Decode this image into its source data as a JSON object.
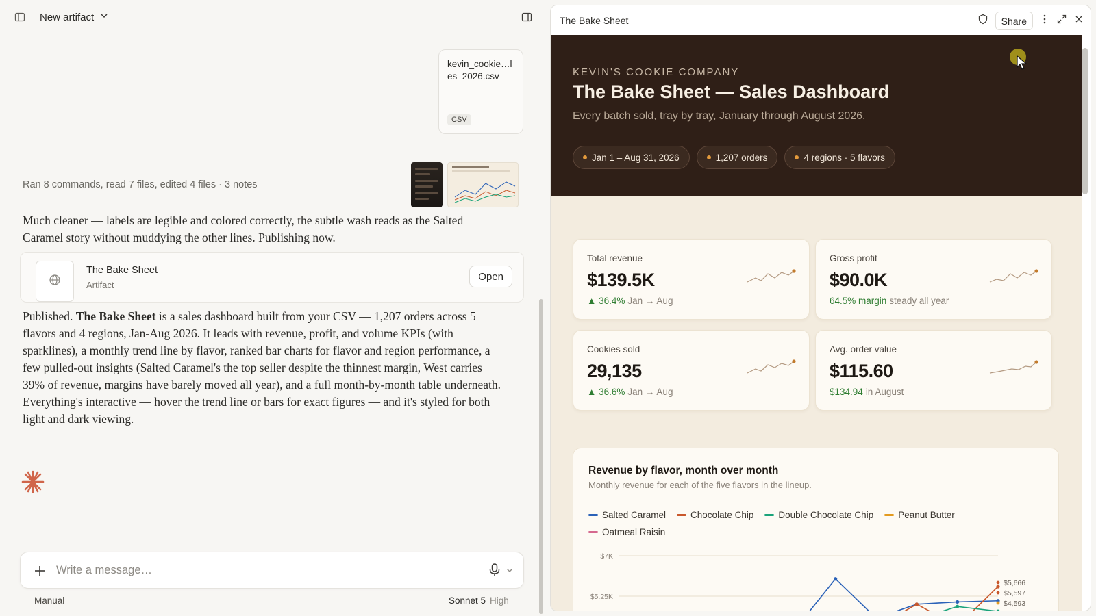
{
  "left": {
    "title": "New artifact",
    "attachment": {
      "name": "kevin_cookie_sales_2026.csv",
      "name_display": "kevin_cookie…les_2026.csv",
      "badge": "CSV"
    },
    "activity": "Ran 8 commands, read 7 files, edited 4 files · 3 notes",
    "message1": "Much cleaner — labels are legible and colored correctly, the subtle wash reads as the Salted Caramel story without muddying the other lines. Publishing now.",
    "artifact_card": {
      "title": "The Bake Sheet",
      "subtitle": "Artifact",
      "open_label": "Open"
    },
    "message2_prefix": "Published. ",
    "message2_bold": "The Bake Sheet",
    "message2_rest": " is a sales dashboard built from your CSV — 1,207 orders across 5 flavors and 4 regions, Jan-Aug 2026. It leads with revenue, profit, and volume KPIs (with sparklines), a monthly trend line by flavor, ranked bar charts for flavor and region performance, a few pulled-out insights (Salted Caramel's the top seller despite the thinnest margin, West carries 39% of revenue, margins have barely moved all year), and a full month-by-month table underneath. Everything's interactive — hover the trend line or bars for exact figures — and it's styled for both light and dark viewing.",
    "composer": {
      "placeholder": "Write a message…"
    },
    "mode": "Manual",
    "model": "Sonnet 5",
    "effort": "High"
  },
  "right": {
    "title": "The Bake Sheet",
    "share_label": "Share",
    "hero": {
      "kicker": "KEVIN'S COOKIE COMPANY",
      "title": "The Bake Sheet — Sales Dashboard",
      "subtitle": "Every batch sold, tray by tray, January through August 2026.",
      "chips": [
        "Jan 1 – Aug 31, 2026",
        "1,207 orders",
        "4 regions · 5 flavors"
      ]
    },
    "kpis": [
      {
        "label": "Total revenue",
        "value": "$139.5K",
        "delta": "▲ 36.4%",
        "note": "Jan → Aug"
      },
      {
        "label": "Gross profit",
        "value": "$90.0K",
        "delta": "64.5% margin",
        "note": "steady all year"
      },
      {
        "label": "Cookies sold",
        "value": "29,135",
        "delta": "▲ 36.6%",
        "note": "Jan → Aug"
      },
      {
        "label": "Avg. order value",
        "value": "$115.60",
        "delta": "$134.94",
        "note": "in August"
      }
    ],
    "chart": {
      "title": "Revenue by flavor, month over month",
      "subtitle": "Monthly revenue for each of the five flavors in the lineup."
    }
  },
  "colors": {
    "salted_caramel": "#2b62b8",
    "chocolate_chip": "#c9582c",
    "double_chocolate_chip": "#1aa37a",
    "peanut_butter": "#e39a1f",
    "oatmeal_raisin": "#d5688e",
    "hero_bg": "#2f1f17",
    "positive": "#2f7d32"
  },
  "chart_data": {
    "type": "line",
    "title": "Revenue by flavor, month over month",
    "y_tick_labels": [
      "$7K",
      "$5.25K"
    ],
    "end_labels": [
      "$5,666",
      "$5,597",
      "$4,593"
    ],
    "series": [
      {
        "name": "Salted Caramel",
        "color": "#2b62b8",
        "values_visible": [
          null,
          null,
          null,
          null,
          3800,
          6000,
          4300,
          4900,
          5000,
          5050
        ]
      },
      {
        "name": "Chocolate Chip",
        "color": "#c9582c",
        "values_visible": [
          null,
          null,
          null,
          null,
          null,
          4200,
          3900,
          4900,
          3950,
          5666
        ]
      },
      {
        "name": "Double Chocolate Chip",
        "color": "#1aa37a",
        "values_visible": [
          null,
          null,
          null,
          null,
          null,
          null,
          null,
          4250,
          4800,
          4593
        ]
      },
      {
        "name": "Peanut Butter",
        "color": "#e39a1f",
        "values_visible": []
      },
      {
        "name": "Oatmeal Raisin",
        "color": "#d5688e",
        "values_visible": []
      }
    ]
  }
}
